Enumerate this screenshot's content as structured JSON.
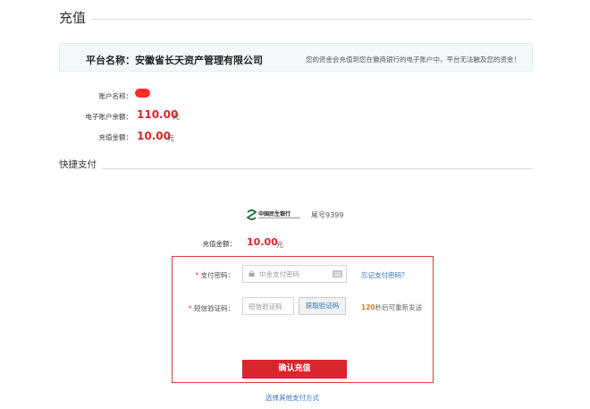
{
  "page": {
    "title": "充值"
  },
  "platform": {
    "name": "平台名称：安徽省长天资产管理有限公司",
    "note": "您的资金会充值到您在徽商银行的电子账户中，平台无法触及您的资金！"
  },
  "account": {
    "name_label": "账户名称：",
    "balance_label": "电子账户余额：",
    "balance_value": "110.00",
    "balance_unit": "元",
    "recharge_label": "充值金额：",
    "recharge_value": "10.00",
    "recharge_unit": "元"
  },
  "quick_pay": {
    "title": "快捷支付",
    "bank_logo_text": "中国民生银行",
    "tail_number": "尾号9399",
    "amount_label": "充值金额：",
    "amount_value": "10.00",
    "amount_unit": "元",
    "required_mark": "*",
    "pwd_label": "支付密码：",
    "pwd_placeholder": "中金支付密码",
    "forgot_pwd": "忘记支付密码？",
    "sms_label": "短信验证码：",
    "sms_placeholder": "短信验证码",
    "get_code": "获取验证码",
    "countdown": "120",
    "countdown_suffix": "秒后可重新发送",
    "confirm": "确认充值",
    "other_method": "选择其他支付方式"
  },
  "colors": {
    "accent_red": "#d9262c",
    "link_blue": "#2f6fc9",
    "countdown_orange": "#e07b1a"
  }
}
